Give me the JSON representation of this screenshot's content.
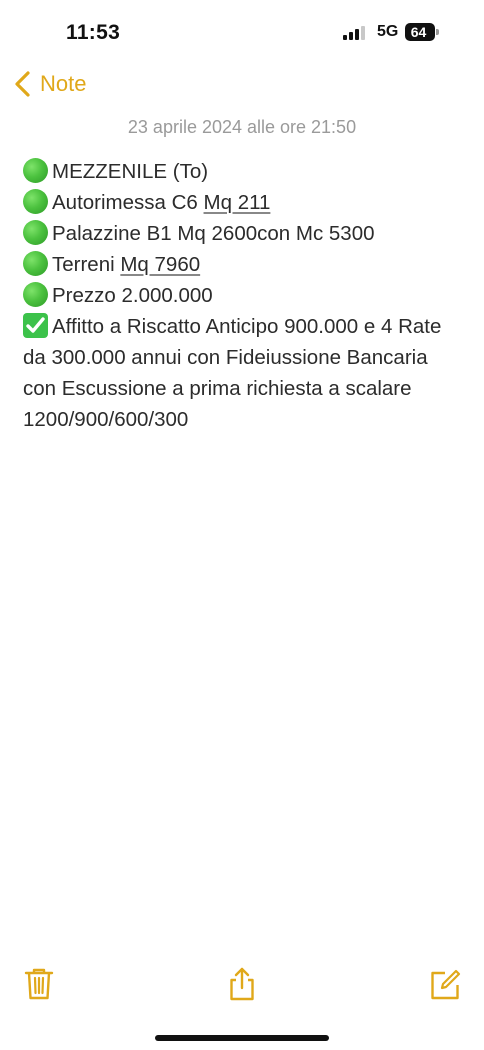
{
  "status_bar": {
    "time": "11:53",
    "network": "5G",
    "battery": "64"
  },
  "nav": {
    "back_label": "Note"
  },
  "note": {
    "date": "23 aprile 2024 alle ore 21:50",
    "lines": [
      {
        "icon": "green-circle-icon",
        "text": "MEZZENILE (To)"
      },
      {
        "icon": "green-circle-icon",
        "text_before": "Autorimessa C6 ",
        "underlined": "Mq 211"
      },
      {
        "icon": "green-circle-icon",
        "text": "Palazzine B1 Mq 2600con Mc 5300"
      },
      {
        "icon": "green-circle-icon",
        "text_before": "Terreni ",
        "underlined": "Mq 7960"
      },
      {
        "icon": "green-circle-icon",
        "text": "Prezzo 2.000.000"
      },
      {
        "icon": "check-mark-button-icon",
        "text": "Affitto a Riscatto Anticipo 900.000 e 4 Rate da 300.000 annui con Fideiussione Bancaria con Escussione a prima richiesta a scalare 1200/900/600/300"
      }
    ]
  },
  "toolbar": {
    "icons": [
      "trash-icon",
      "share-icon",
      "compose-icon"
    ]
  },
  "colors": {
    "accent": "#e0a81a",
    "date_text": "#9a9a9a",
    "body_text": "#2c2c2c"
  }
}
